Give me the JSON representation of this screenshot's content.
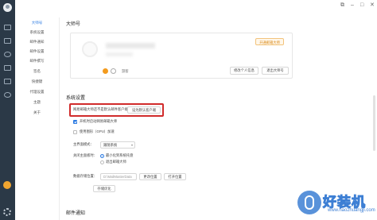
{
  "window": {
    "controls": {
      "pin": "⧉",
      "minimize": "–",
      "maximize": "□",
      "close": "✕"
    }
  },
  "rail": {
    "icons": [
      "mail-icon",
      "calendar-icon",
      "contacts-icon",
      "clip-icon",
      "doc-icon",
      "cloud-icon"
    ]
  },
  "nav": {
    "items": [
      {
        "label": "大师号",
        "active": true
      },
      {
        "label": "系统设置",
        "active": false
      },
      {
        "label": "邮件通知",
        "active": false
      },
      {
        "label": "邮件设置",
        "active": false
      },
      {
        "label": "邮件撰写",
        "active": false
      },
      {
        "label": "签名",
        "active": false
      },
      {
        "label": "快捷键",
        "active": false
      },
      {
        "label": "代理设置",
        "active": false
      },
      {
        "label": "主题",
        "active": false
      },
      {
        "label": "关于",
        "active": false
      }
    ]
  },
  "account": {
    "section_title": "大师号",
    "tag": "开通邮箱大师",
    "level_label": "游客",
    "edit_profile_button": "修改个人信息",
    "leave_button": "退出大师号"
  },
  "system": {
    "section_title": "系统设置",
    "default_client_text": "网易邮箱大师还不是默认邮件客户端",
    "set_default_button": "设为默认客户端",
    "startup_checkbox": "开机时启动网易邮箱大师",
    "gpu_checkbox": "使用图形（GPU）加速",
    "theme_label": "主界面模式：",
    "theme_value": "跟随系统",
    "close_label": "关闭主面板时：",
    "close_option_1": "最小化到系统托盘",
    "close_option_2": "退出邮箱大师",
    "data_label": "数据存储位置：",
    "data_path": "D:\\MailMasterData",
    "change_location_button": "更改位置",
    "open_location_button": "打开位置",
    "storage_button": "存储优化"
  },
  "mail_notify": {
    "section_title": "邮件通知"
  },
  "watermark": {
    "text": "好装机",
    "sub": "www.haozhuangji.com"
  },
  "colors": {
    "rail_bg": "#2b3947",
    "accent": "#2a7ae2",
    "highlight_box": "#d12b2b",
    "vip_orange": "#f39b1e"
  }
}
